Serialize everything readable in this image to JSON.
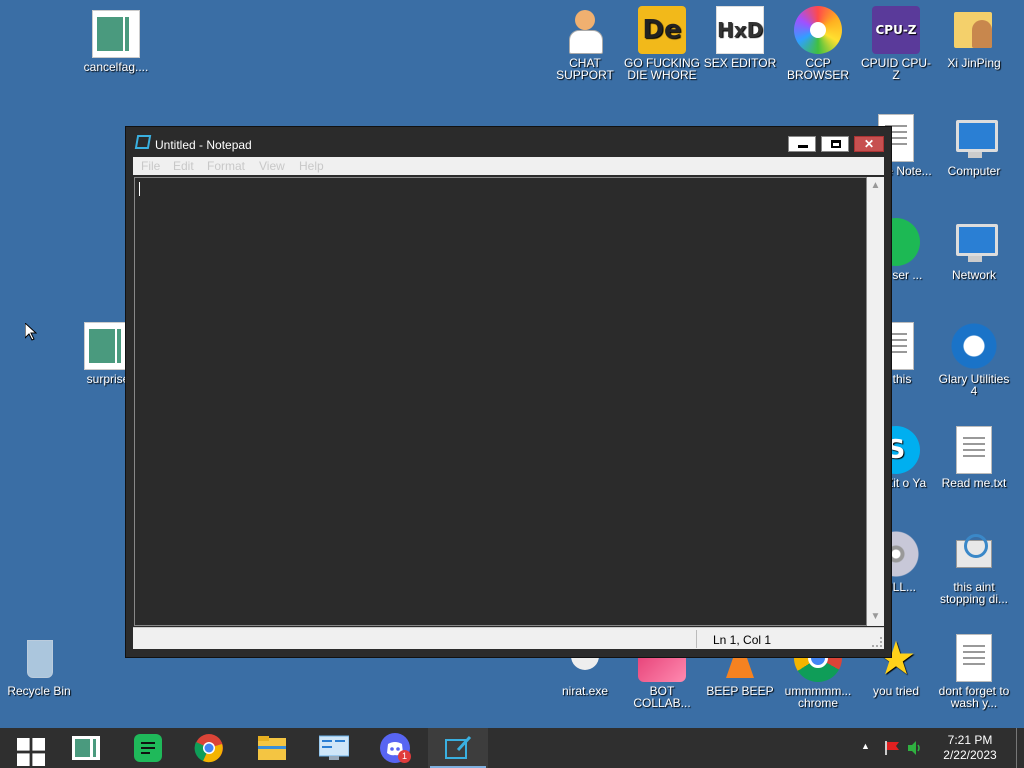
{
  "desktop": {
    "icons": {
      "cancelfag": "cancelfag....",
      "chat_support": "CHAT SUPPORT",
      "go_fucking": "GO FUCKING DIE WHORE",
      "sex_editor": "SEX EDITOR",
      "ccp_browser": "CCP BROWSER",
      "cpuid": "CPUID CPU-Z",
      "xi_jinping": "Xi JinPing",
      "ware_note": "eware Note...",
      "computer": "Computer",
      "spot_ser": "sed ser ...",
      "network": "Network",
      "surprise": "surprise",
      "is_this": "is this",
      "glary": "Glary Utilities 4",
      "what_zit": "hat Zit o Ya",
      "read_me": "Read me.txt",
      "bull": "BULL...",
      "this_aint": "this aint stopping di...",
      "recycle_bin": "Recycle Bin",
      "nirat": "nirat.exe",
      "bot_collab": "BOT COLLAB...",
      "beep_beep": "BEEP BEEP",
      "ummmm_chrome": "ummmmm... chrome",
      "you_tried": "you tried",
      "dont_forget": "dont forget to wash y..."
    }
  },
  "notepad": {
    "title": "Untitled - Notepad",
    "menu": [
      "File",
      "Edit",
      "Format",
      "View",
      "Help"
    ],
    "content": "",
    "status_position": "Ln 1, Col 1"
  },
  "taskbar": {
    "apps": [
      "start-icon",
      "green-app-icon",
      "notes-app-icon",
      "chrome-icon",
      "file-explorer-icon",
      "control-panel-icon",
      "discord-icon",
      "notepad-icon"
    ],
    "discord_badge": "1",
    "clock_time": "7:21 PM",
    "clock_date": "2/22/2023"
  },
  "colors": {
    "desktop": "#3a6ea5",
    "window_frame": "#2b2b2b",
    "close_button": "#c75050",
    "taskbar": "#2f2f2f"
  }
}
